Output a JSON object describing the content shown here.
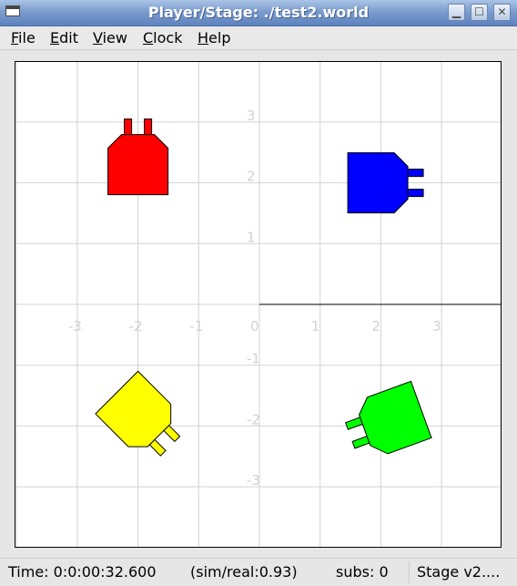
{
  "window": {
    "title": "Player/Stage: ./test2.world",
    "minimize_glyph": "▁",
    "maximize_glyph": "☐",
    "close_glyph": "✕"
  },
  "menu": {
    "items": [
      {
        "accel": "F",
        "rest": "ile"
      },
      {
        "accel": "E",
        "rest": "dit"
      },
      {
        "accel": "V",
        "rest": "iew"
      },
      {
        "accel": "C",
        "rest": "lock"
      },
      {
        "accel": "H",
        "rest": "elp"
      }
    ]
  },
  "world": {
    "grid_color": "#d3d3d3",
    "tick_color": "#d2d2d2",
    "x_ticks": [
      "-3",
      "-2",
      "-1",
      "0",
      "1",
      "2",
      "3"
    ],
    "y_ticks": [
      "3",
      "2",
      "1",
      "-1",
      "-2",
      "-3"
    ],
    "robots": [
      {
        "name": "red",
        "color": "#ff0000",
        "x": -2.0,
        "y": 2.3,
        "heading_deg": 90
      },
      {
        "name": "blue",
        "color": "#0000ff",
        "x": 1.95,
        "y": 2.0,
        "heading_deg": 0
      },
      {
        "name": "yellow",
        "color": "#ffff00",
        "x": -2.0,
        "y": -1.8,
        "heading_deg": -45
      },
      {
        "name": "green",
        "color": "#00ff00",
        "x": 2.2,
        "y": -1.9,
        "heading_deg": 200
      }
    ]
  },
  "status": {
    "time": "Time: 0:0:00:32.600",
    "ratio": "(sim/real:0.93)",
    "subs": "subs: 0",
    "version": "Stage v2...."
  }
}
